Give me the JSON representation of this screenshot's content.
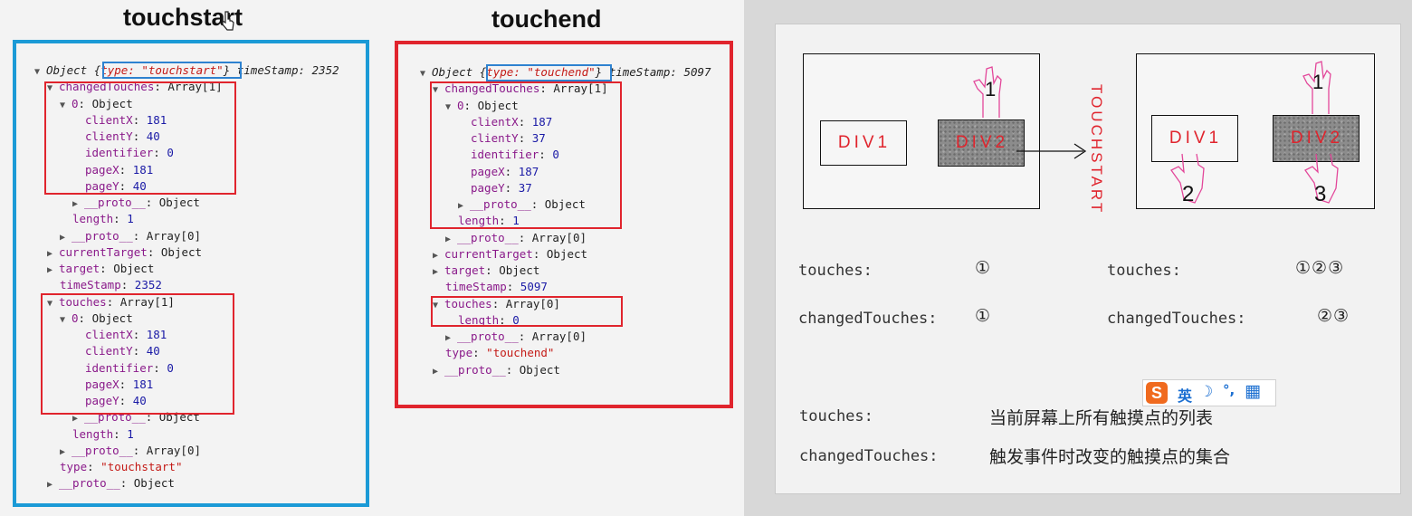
{
  "left": {
    "heading_start": "touchstart",
    "heading_end": "touchend",
    "start_lines": [
      {
        "pre": "▼ ",
        "parts": [
          [
            "Object ",
            "ital"
          ],
          [
            "{",
            "ital"
          ],
          [
            "type: \"touchstart\"",
            "str ital"
          ],
          [
            "}",
            "ital"
          ],
          [
            " timeStamp: 2352",
            "ital"
          ]
        ]
      },
      {
        "pre": "▼ ",
        "parts": [
          [
            "changedTouches",
            "key"
          ],
          [
            ": Array[1]",
            ""
          ]
        ]
      },
      {
        "pre": "▼ ",
        "parts": [
          [
            "0",
            "key"
          ],
          [
            ": Object",
            ""
          ]
        ]
      },
      {
        "pre": "",
        "parts": [
          [
            "clientX",
            "key"
          ],
          [
            ": ",
            ""
          ],
          [
            "181",
            "num"
          ]
        ]
      },
      {
        "pre": "",
        "parts": [
          [
            "clientY",
            "key"
          ],
          [
            ": ",
            ""
          ],
          [
            "40",
            "num"
          ]
        ]
      },
      {
        "pre": "",
        "parts": [
          [
            "identifier",
            "key"
          ],
          [
            ": ",
            ""
          ],
          [
            "0",
            "num"
          ]
        ]
      },
      {
        "pre": "",
        "parts": [
          [
            "pageX",
            "key"
          ],
          [
            ": ",
            ""
          ],
          [
            "181",
            "num"
          ]
        ]
      },
      {
        "pre": "",
        "parts": [
          [
            "pageY",
            "key"
          ],
          [
            ": ",
            ""
          ],
          [
            "40",
            "num"
          ]
        ]
      },
      {
        "pre": "▶ ",
        "parts": [
          [
            "__proto__",
            "key"
          ],
          [
            ": Object",
            ""
          ]
        ]
      },
      {
        "pre": "",
        "parts": [
          [
            "length",
            "key"
          ],
          [
            ": ",
            ""
          ],
          [
            "1",
            "num"
          ]
        ]
      },
      {
        "pre": "▶ ",
        "parts": [
          [
            "__proto__",
            "key"
          ],
          [
            ": Array[0]",
            ""
          ]
        ]
      },
      {
        "pre": "▶ ",
        "parts": [
          [
            "currentTarget",
            "key"
          ],
          [
            ": Object",
            ""
          ]
        ]
      },
      {
        "pre": "▶ ",
        "parts": [
          [
            "target",
            "key"
          ],
          [
            ": Object",
            ""
          ]
        ]
      },
      {
        "pre": "",
        "parts": [
          [
            "timeStamp",
            "key"
          ],
          [
            ": ",
            ""
          ],
          [
            "2352",
            "num"
          ]
        ]
      },
      {
        "pre": "▼ ",
        "parts": [
          [
            "touches",
            "key"
          ],
          [
            ": Array[1]",
            ""
          ]
        ]
      },
      {
        "pre": "▼ ",
        "parts": [
          [
            "0",
            "key"
          ],
          [
            ": Object",
            ""
          ]
        ]
      },
      {
        "pre": "",
        "parts": [
          [
            "clientX",
            "key"
          ],
          [
            ": ",
            ""
          ],
          [
            "181",
            "num"
          ]
        ]
      },
      {
        "pre": "",
        "parts": [
          [
            "clientY",
            "key"
          ],
          [
            ": ",
            ""
          ],
          [
            "40",
            "num"
          ]
        ]
      },
      {
        "pre": "",
        "parts": [
          [
            "identifier",
            "key"
          ],
          [
            ": ",
            ""
          ],
          [
            "0",
            "num"
          ]
        ]
      },
      {
        "pre": "",
        "parts": [
          [
            "pageX",
            "key"
          ],
          [
            ": ",
            ""
          ],
          [
            "181",
            "num"
          ]
        ]
      },
      {
        "pre": "",
        "parts": [
          [
            "pageY",
            "key"
          ],
          [
            ": ",
            ""
          ],
          [
            "40",
            "num"
          ]
        ]
      },
      {
        "pre": "▶ ",
        "parts": [
          [
            "__proto__",
            "key"
          ],
          [
            ": Object",
            ""
          ]
        ]
      },
      {
        "pre": "",
        "parts": [
          [
            "length",
            "key"
          ],
          [
            ": ",
            ""
          ],
          [
            "1",
            "num"
          ]
        ]
      },
      {
        "pre": "▶ ",
        "parts": [
          [
            "__proto__",
            "key"
          ],
          [
            ": Array[0]",
            ""
          ]
        ]
      },
      {
        "pre": "",
        "parts": [
          [
            "type",
            "key"
          ],
          [
            ": ",
            ""
          ],
          [
            "\"touchstart\"",
            "str"
          ]
        ]
      },
      {
        "pre": "▶ ",
        "parts": [
          [
            "__proto__",
            "key"
          ],
          [
            ": Object",
            ""
          ]
        ]
      }
    ],
    "end_lines": [
      {
        "pre": "▼ ",
        "parts": [
          [
            "Object ",
            "ital"
          ],
          [
            "{",
            "ital"
          ],
          [
            "type: \"touchend\"",
            "str ital"
          ],
          [
            "}",
            "ital"
          ],
          [
            " timeStamp: 5097",
            "ital"
          ]
        ]
      },
      {
        "pre": "▼ ",
        "parts": [
          [
            "changedTouches",
            "key"
          ],
          [
            ": Array[1]",
            ""
          ]
        ]
      },
      {
        "pre": "▼ ",
        "parts": [
          [
            "0",
            "key"
          ],
          [
            ": Object",
            ""
          ]
        ]
      },
      {
        "pre": "",
        "parts": [
          [
            "clientX",
            "key"
          ],
          [
            ": ",
            ""
          ],
          [
            "187",
            "num"
          ]
        ]
      },
      {
        "pre": "",
        "parts": [
          [
            "clientY",
            "key"
          ],
          [
            ": ",
            ""
          ],
          [
            "37",
            "num"
          ]
        ]
      },
      {
        "pre": "",
        "parts": [
          [
            "identifier",
            "key"
          ],
          [
            ": ",
            ""
          ],
          [
            "0",
            "num"
          ]
        ]
      },
      {
        "pre": "",
        "parts": [
          [
            "pageX",
            "key"
          ],
          [
            ": ",
            ""
          ],
          [
            "187",
            "num"
          ]
        ]
      },
      {
        "pre": "",
        "parts": [
          [
            "pageY",
            "key"
          ],
          [
            ": ",
            ""
          ],
          [
            "37",
            "num"
          ]
        ]
      },
      {
        "pre": "▶ ",
        "parts": [
          [
            "__proto__",
            "key"
          ],
          [
            ": Object",
            ""
          ]
        ]
      },
      {
        "pre": "",
        "parts": [
          [
            "length",
            "key"
          ],
          [
            ": ",
            ""
          ],
          [
            "1",
            "num"
          ]
        ]
      },
      {
        "pre": "▶ ",
        "parts": [
          [
            "__proto__",
            "key"
          ],
          [
            ": Array[0]",
            ""
          ]
        ]
      },
      {
        "pre": "▶ ",
        "parts": [
          [
            "currentTarget",
            "key"
          ],
          [
            ": Object",
            ""
          ]
        ]
      },
      {
        "pre": "▶ ",
        "parts": [
          [
            "target",
            "key"
          ],
          [
            ": Object",
            ""
          ]
        ]
      },
      {
        "pre": "",
        "parts": [
          [
            "timeStamp",
            "key"
          ],
          [
            ": ",
            ""
          ],
          [
            "5097",
            "num"
          ]
        ]
      },
      {
        "pre": "▼ ",
        "parts": [
          [
            "touches",
            "key"
          ],
          [
            ": Array[0]",
            ""
          ]
        ]
      },
      {
        "pre": "",
        "parts": [
          [
            "length",
            "key"
          ],
          [
            ": ",
            ""
          ],
          [
            "0",
            "num"
          ]
        ]
      },
      {
        "pre": "▶ ",
        "parts": [
          [
            "__proto__",
            "key"
          ],
          [
            ": Array[0]",
            ""
          ]
        ]
      },
      {
        "pre": "",
        "parts": [
          [
            "type",
            "key"
          ],
          [
            ": ",
            ""
          ],
          [
            "\"touchend\"",
            "str"
          ]
        ]
      },
      {
        "pre": "▶ ",
        "parts": [
          [
            "__proto__",
            "key"
          ],
          [
            ": Object",
            ""
          ]
        ]
      }
    ]
  },
  "slide": {
    "div1": "DIV1",
    "div2": "DIV2",
    "vertical_label": "TOUCHSTART",
    "hand_numbers": [
      "1",
      "2",
      "3"
    ],
    "touches_label": "touches:",
    "changed_label": "changedTouches:",
    "left_touches_val": "①",
    "left_changed_val": "①",
    "right_touches_val": "①②③",
    "right_changed_val": "②③",
    "def_touches_label": "touches:",
    "def_touches_text": "当前屏幕上所有触摸点的列表",
    "def_changed_label": "changedTouches:",
    "def_changed_text": "触发事件时改变的触摸点的集合"
  },
  "ime": {
    "logo": "S",
    "lang": "英",
    "moon": "☽",
    "punct": "°,",
    "grid": "▦"
  },
  "colors": {
    "blue_frame": "#1b9ad6",
    "red_frame": "#e0242d",
    "ime_orange": "#f06a1e"
  }
}
